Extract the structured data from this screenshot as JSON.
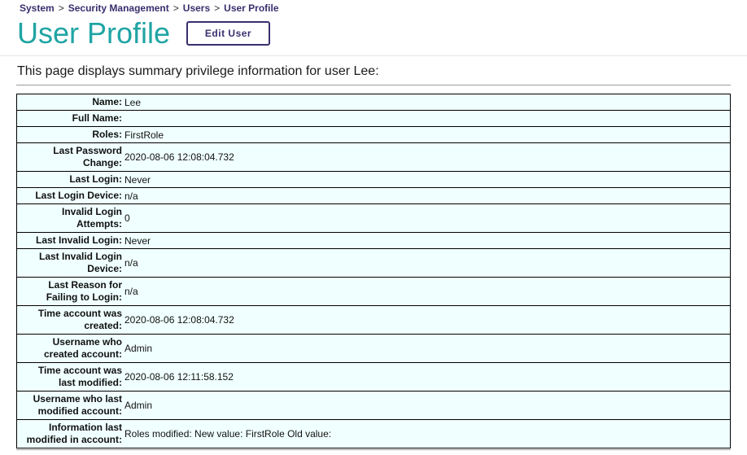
{
  "breadcrumb": {
    "items": [
      "System",
      "Security Management",
      "Users",
      "User Profile"
    ],
    "separator": ">"
  },
  "page": {
    "title": "User Profile",
    "edit_button": "Edit User",
    "description": "This page displays summary privilege information for user Lee:"
  },
  "profile": {
    "rows": [
      {
        "label": "Name:",
        "value": "Lee",
        "lines": 1
      },
      {
        "label": "Full Name:",
        "value": "",
        "lines": 1
      },
      {
        "label": "Roles:",
        "value": "FirstRole",
        "lines": 1
      },
      {
        "label": "Last Password Change:",
        "value": "2020-08-06 12:08:04.732",
        "lines": 2
      },
      {
        "label": "Last Login:",
        "value": "Never",
        "lines": 1
      },
      {
        "label": "Last Login Device:",
        "value": "n/a",
        "lines": 1
      },
      {
        "label": "Invalid Login Attempts:",
        "value": "0",
        "lines": 2
      },
      {
        "label": "Last Invalid Login:",
        "value": "Never",
        "lines": 1
      },
      {
        "label": "Last Invalid Login Device:",
        "value": "n/a",
        "lines": 2
      },
      {
        "label": "Last Reason for Failing to Login:",
        "value": "n/a",
        "lines": 2
      },
      {
        "label": "Time account was created:",
        "value": "2020-08-06 12:08:04.732",
        "lines": 2
      },
      {
        "label": "Username who created account:",
        "value": "Admin",
        "lines": 2
      },
      {
        "label": "Time account was last modified:",
        "value": "2020-08-06 12:11:58.152",
        "lines": 2
      },
      {
        "label": "Username who last modified account:",
        "value": "Admin",
        "lines": 2
      },
      {
        "label": "Information last modified in account:",
        "value": "Roles modified: New value: FirstRole Old value:",
        "lines": 2
      }
    ]
  },
  "colors": {
    "accent_teal": "#20a4a4",
    "nav_purple": "#3a2e6e",
    "row_background": "#f0ffff"
  }
}
